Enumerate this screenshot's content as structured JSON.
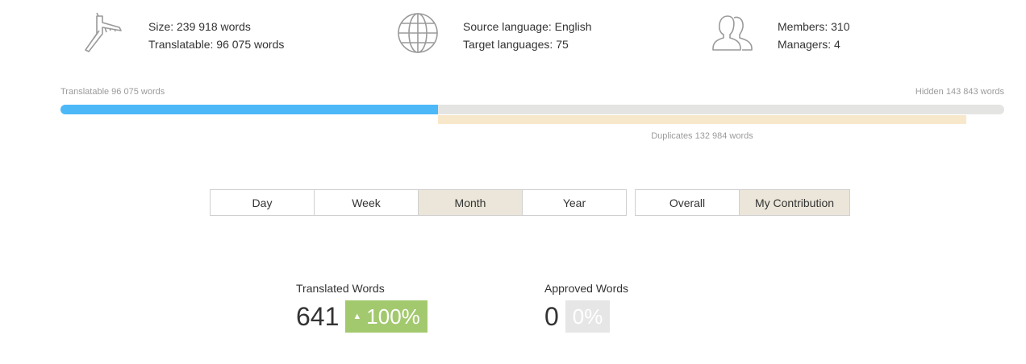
{
  "stats": {
    "size": {
      "line1": "Size: 239 918 words",
      "line2": "Translatable: 96 075 words",
      "icon": "calipers-icon"
    },
    "language": {
      "line1": "Source language: English",
      "line2": "Target languages: 75",
      "icon": "globe-icon"
    },
    "members": {
      "line1": "Members: 310",
      "line2": "Managers: 4",
      "icon": "users-icon"
    }
  },
  "progress": {
    "translatable_label": "Translatable 96 075 words",
    "hidden_label": "Hidden 143 843 words",
    "duplicates_label": "Duplicates 132 984 words",
    "translatable_fraction": 0.4,
    "colors": {
      "fill": "#4db8f8",
      "track": "#e4e4e2",
      "duplicates": "#f8e8cb"
    }
  },
  "period_tabs": [
    {
      "label": "Day",
      "active": false
    },
    {
      "label": "Week",
      "active": false
    },
    {
      "label": "Month",
      "active": true
    },
    {
      "label": "Year",
      "active": false
    }
  ],
  "scope_tabs": [
    {
      "label": "Overall",
      "active": false
    },
    {
      "label": "My Contribution",
      "active": true
    }
  ],
  "metrics": {
    "translated": {
      "label": "Translated Words",
      "value": "641",
      "change": "100%",
      "trend_icon": "arrow-up-icon"
    },
    "approved": {
      "label": "Approved Words",
      "value": "0",
      "change": "0%"
    }
  }
}
